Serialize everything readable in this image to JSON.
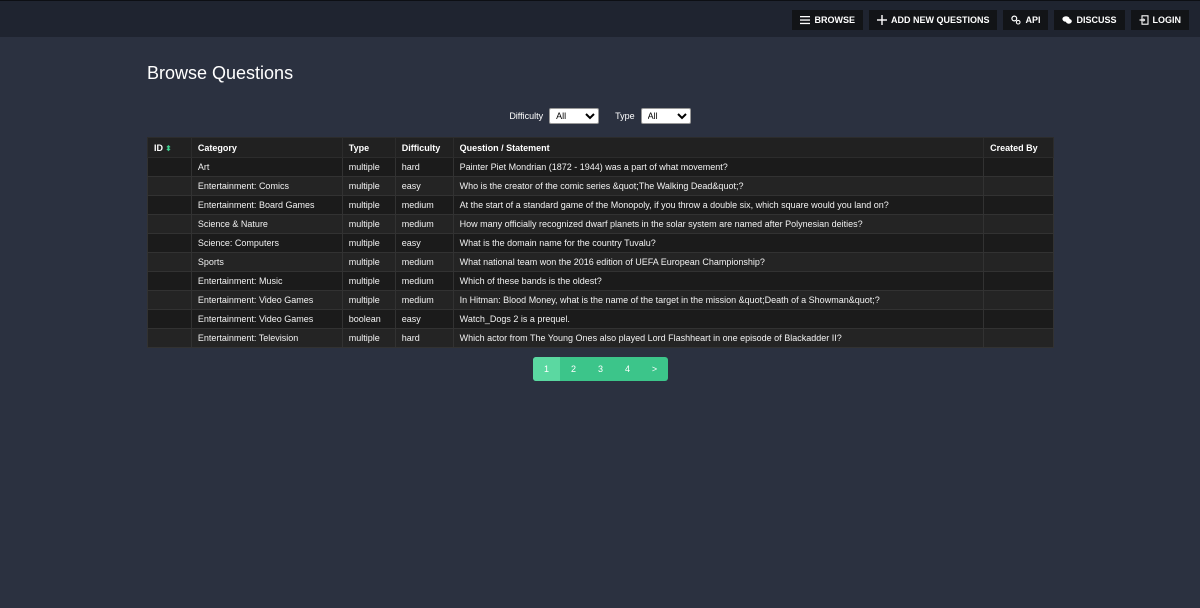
{
  "nav": {
    "browse": "BROWSE",
    "add": "ADD NEW QUESTIONS",
    "api": "API",
    "discuss": "DISCUSS",
    "login": "LOGIN"
  },
  "page_title": "Browse Questions",
  "filters": {
    "difficulty_label": "Difficulty",
    "difficulty_value": "All",
    "type_label": "Type",
    "type_value": "All"
  },
  "table": {
    "headers": {
      "id": "ID",
      "category": "Category",
      "type": "Type",
      "difficulty": "Difficulty",
      "question": "Question / Statement",
      "created_by": "Created By"
    },
    "rows": [
      {
        "id": "",
        "category": "Art",
        "type": "multiple",
        "difficulty": "hard",
        "question": "Painter Piet Mondrian (1872 - 1944) was a part of what movement?",
        "created_by": ""
      },
      {
        "id": "",
        "category": "Entertainment: Comics",
        "type": "multiple",
        "difficulty": "easy",
        "question": "Who is the creator of the comic series &quot;The Walking Dead&quot;?",
        "created_by": ""
      },
      {
        "id": "",
        "category": "Entertainment: Board Games",
        "type": "multiple",
        "difficulty": "medium",
        "question": "At the start of a standard game of the Monopoly, if you throw a double six, which square would you land on?",
        "created_by": ""
      },
      {
        "id": "",
        "category": "Science & Nature",
        "type": "multiple",
        "difficulty": "medium",
        "question": "How many officially recognized dwarf planets in the solar system are named after Polynesian deities?",
        "created_by": ""
      },
      {
        "id": "",
        "category": "Science: Computers",
        "type": "multiple",
        "difficulty": "easy",
        "question": "What is the domain name for the country Tuvalu?",
        "created_by": ""
      },
      {
        "id": "",
        "category": "Sports",
        "type": "multiple",
        "difficulty": "medium",
        "question": "What national team won the 2016 edition of UEFA European Championship?",
        "created_by": ""
      },
      {
        "id": "",
        "category": "Entertainment: Music",
        "type": "multiple",
        "difficulty": "medium",
        "question": "Which of these bands is the oldest?",
        "created_by": ""
      },
      {
        "id": "",
        "category": "Entertainment: Video Games",
        "type": "multiple",
        "difficulty": "medium",
        "question": "In Hitman: Blood Money, what is the name of the target in the mission &quot;Death of a Showman&quot;?",
        "created_by": ""
      },
      {
        "id": "",
        "category": "Entertainment: Video Games",
        "type": "boolean",
        "difficulty": "easy",
        "question": "Watch_Dogs 2 is a prequel.",
        "created_by": ""
      },
      {
        "id": "",
        "category": "Entertainment: Television",
        "type": "multiple",
        "difficulty": "hard",
        "question": "Which actor from The Young Ones also played Lord Flashheart in one episode of Blackadder II?",
        "created_by": ""
      }
    ]
  },
  "pagination": {
    "pages": [
      "1",
      "2",
      "3",
      "4"
    ],
    "next": ">",
    "active": "1"
  },
  "colors": {
    "background": "#2b3140",
    "accent": "#3cc58a"
  }
}
